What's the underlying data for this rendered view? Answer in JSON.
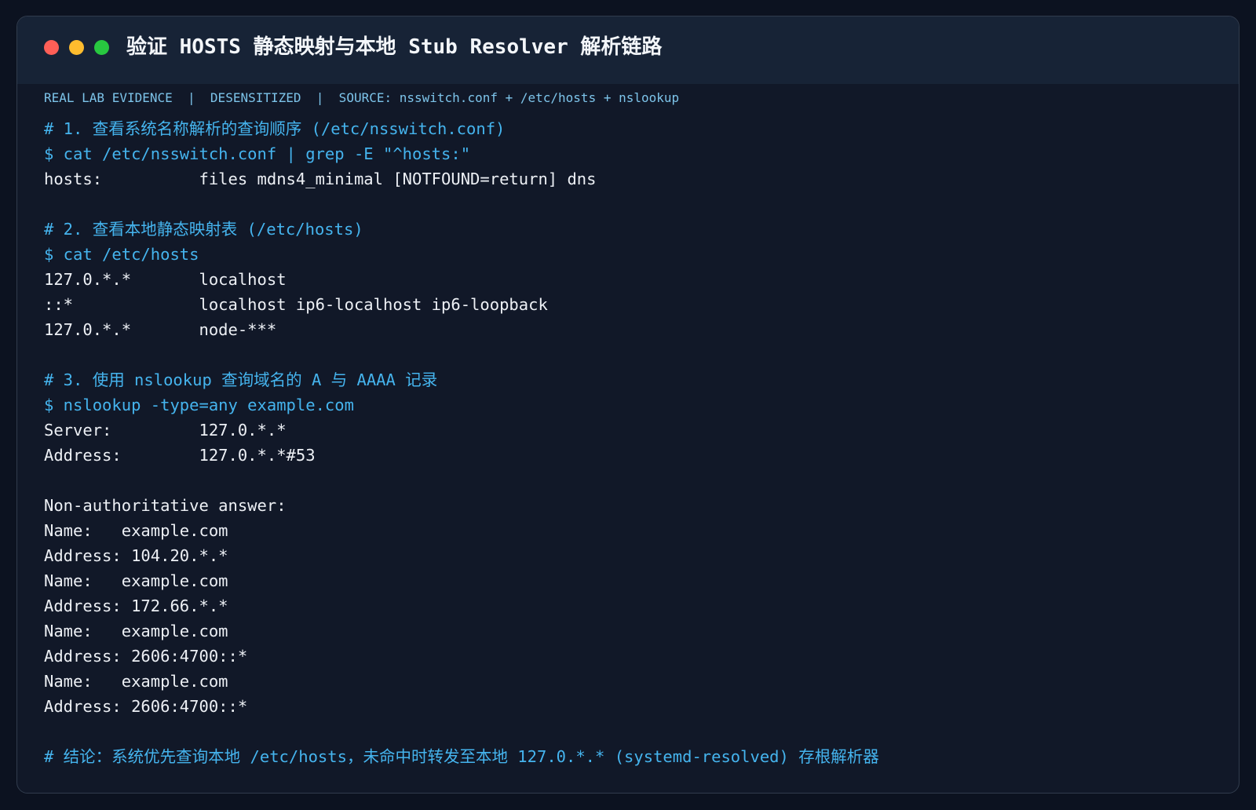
{
  "window": {
    "title": "验证 HOSTS 静态映射与本地 Stub Resolver 解析链路",
    "meta": "REAL LAB EVIDENCE  |  DESENSITIZED  |  SOURCE: nsswitch.conf + /etc/hosts + nslookup"
  },
  "terminal": {
    "lines": [
      {
        "kind": "comment",
        "text": "# 1. 查看系统名称解析的查询顺序 (/etc/nsswitch.conf)"
      },
      {
        "kind": "command",
        "text": "$ cat /etc/nsswitch.conf | grep -E \"^hosts:\""
      },
      {
        "kind": "output",
        "text": "hosts:          files mdns4_minimal [NOTFOUND=return] dns"
      },
      {
        "kind": "blank",
        "text": ""
      },
      {
        "kind": "comment",
        "text": "# 2. 查看本地静态映射表 (/etc/hosts)"
      },
      {
        "kind": "command",
        "text": "$ cat /etc/hosts"
      },
      {
        "kind": "output",
        "text": "127.0.*.*       localhost"
      },
      {
        "kind": "output",
        "text": "::*             localhost ip6-localhost ip6-loopback"
      },
      {
        "kind": "output",
        "text": "127.0.*.*       node-***"
      },
      {
        "kind": "blank",
        "text": ""
      },
      {
        "kind": "comment",
        "text": "# 3. 使用 nslookup 查询域名的 A 与 AAAA 记录"
      },
      {
        "kind": "command",
        "text": "$ nslookup -type=any example.com"
      },
      {
        "kind": "output",
        "text": "Server:         127.0.*.*"
      },
      {
        "kind": "output",
        "text": "Address:        127.0.*.*#53"
      },
      {
        "kind": "blank",
        "text": ""
      },
      {
        "kind": "output",
        "text": "Non-authoritative answer:"
      },
      {
        "kind": "output",
        "text": "Name:   example.com"
      },
      {
        "kind": "output",
        "text": "Address: 104.20.*.*"
      },
      {
        "kind": "output",
        "text": "Name:   example.com"
      },
      {
        "kind": "output",
        "text": "Address: 172.66.*.*"
      },
      {
        "kind": "output",
        "text": "Name:   example.com"
      },
      {
        "kind": "output",
        "text": "Address: 2606:4700::*"
      },
      {
        "kind": "output",
        "text": "Name:   example.com"
      },
      {
        "kind": "output",
        "text": "Address: 2606:4700::*"
      },
      {
        "kind": "blank",
        "text": ""
      },
      {
        "kind": "comment",
        "text": "# 结论：系统优先查询本地 /etc/hosts，未命中时转发至本地 127.0.*.* (systemd-resolved) 存根解析器"
      }
    ]
  }
}
